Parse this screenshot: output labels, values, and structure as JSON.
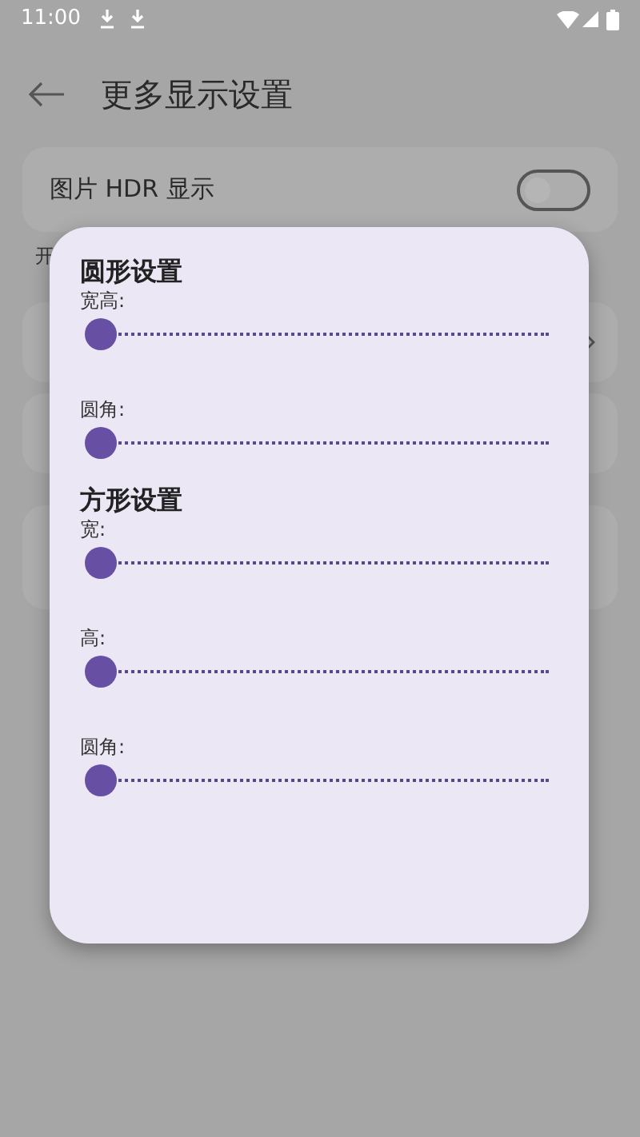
{
  "status_bar": {
    "time": "11:00"
  },
  "header": {
    "title": "更多显示设置"
  },
  "settings": [
    {
      "label": "图片 HDR 显示",
      "on": false
    }
  ],
  "section_hint": "开",
  "dialog": {
    "sections": [
      {
        "title": "圆形设置",
        "sliders": [
          {
            "label": "宽高:",
            "level": 0
          },
          {
            "label": "圆角:",
            "level": 0
          }
        ]
      },
      {
        "title": "方形设置",
        "sliders": [
          {
            "label": "宽:",
            "level": 0
          },
          {
            "label": "高:",
            "level": 0
          },
          {
            "label": "圆角:",
            "level": 0
          }
        ]
      }
    ]
  }
}
